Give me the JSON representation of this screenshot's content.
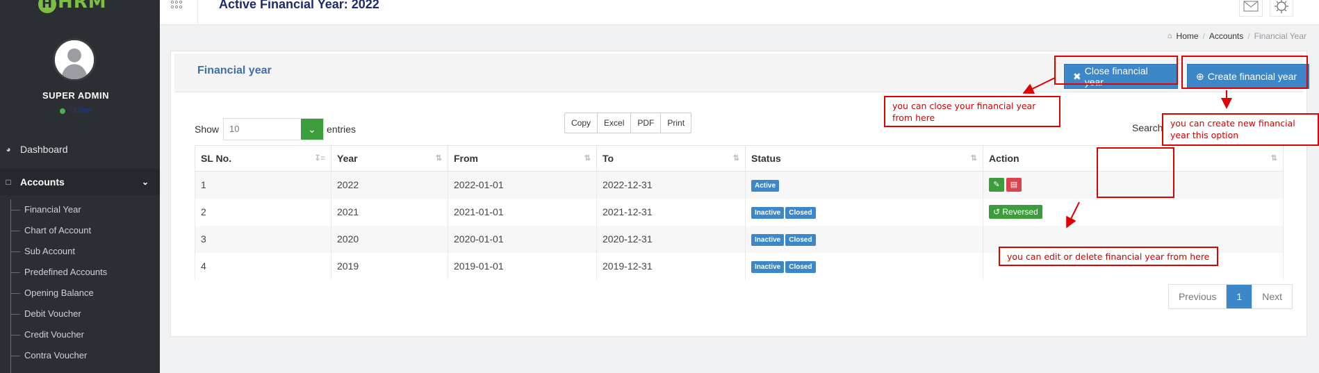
{
  "app": {
    "logo": "HRM",
    "page_title": "Active Financial Year: 2022"
  },
  "user": {
    "name": "SUPER ADMIN",
    "status": "Online"
  },
  "sidebar": {
    "items": [
      {
        "label": "Dashboard",
        "icon": "dashboard-icon"
      },
      {
        "label": "Accounts",
        "icon": "briefcase-icon"
      }
    ],
    "sub_items": [
      "Financial Year",
      "Chart of Account",
      "Sub Account",
      "Predefined Accounts",
      "Opening Balance",
      "Debit Voucher",
      "Credit Voucher",
      "Contra Voucher"
    ]
  },
  "breadcrumb": {
    "home": "Home",
    "section": "Accounts",
    "current": "Financial Year"
  },
  "card": {
    "title": "Financial year",
    "close_btn": "Close financial year",
    "create_btn": "Create financial year"
  },
  "table_controls": {
    "show_label": "Show",
    "entries_value": "10",
    "entries_label": "entries",
    "export": [
      "Copy",
      "Excel",
      "PDF",
      "Print"
    ],
    "search_label": "Search:"
  },
  "table": {
    "headers": [
      "SL No.",
      "Year",
      "From",
      "To",
      "Status",
      "Action"
    ],
    "rows": [
      {
        "sl": "1",
        "year": "2022",
        "from": "2022-01-01",
        "to": "2022-12-31",
        "status": [
          "Active"
        ],
        "action": "edit-delete"
      },
      {
        "sl": "2",
        "year": "2021",
        "from": "2021-01-01",
        "to": "2021-12-31",
        "status": [
          "Inactive",
          "Closed"
        ],
        "action": "Reversed"
      },
      {
        "sl": "3",
        "year": "2020",
        "from": "2020-01-01",
        "to": "2020-12-31",
        "status": [
          "Inactive",
          "Closed"
        ],
        "action": ""
      },
      {
        "sl": "4",
        "year": "2019",
        "from": "2019-01-01",
        "to": "2019-12-31",
        "status": [
          "Inactive",
          "Closed"
        ],
        "action": ""
      }
    ]
  },
  "pagination": {
    "prev": "Previous",
    "page": "1",
    "next": "Next"
  },
  "annotations": {
    "close_note": "you can close your financial year from here",
    "create_note": "you can create new financial year this option",
    "action_note": "you can edit or delete financial year from here"
  }
}
